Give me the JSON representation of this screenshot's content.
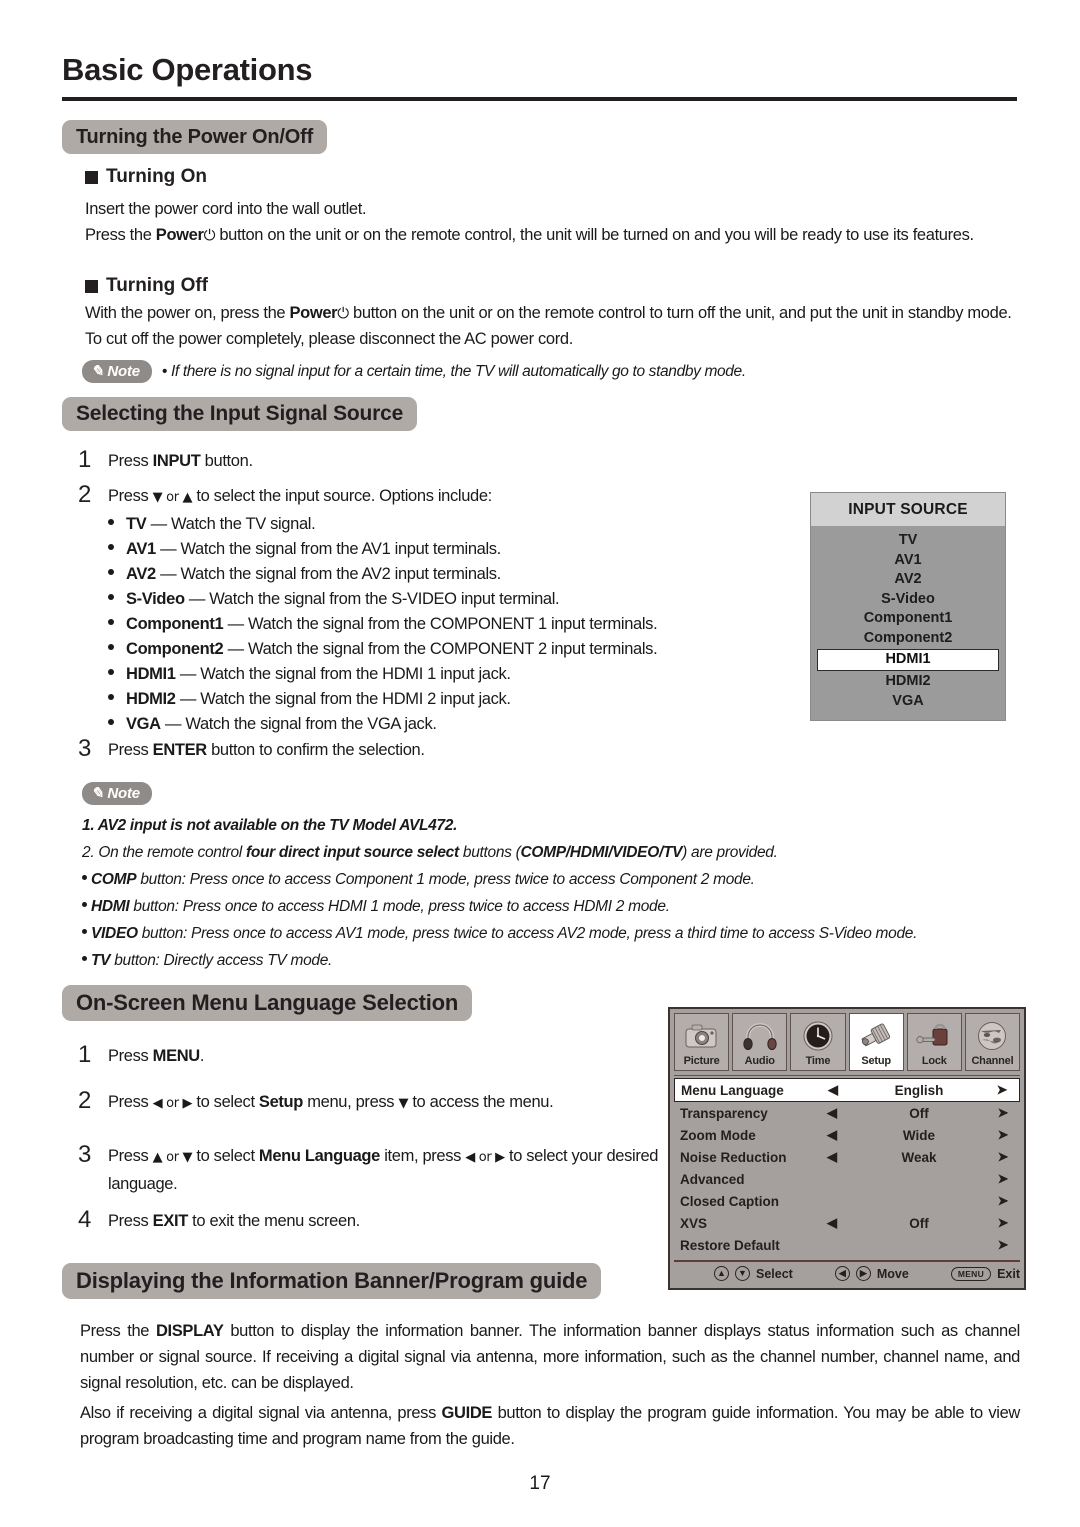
{
  "page": {
    "title": "Basic Operations",
    "number": "17"
  },
  "section_power": {
    "heading": "Turning the Power On/Off",
    "turning_on": {
      "heading": "Turning On",
      "line1": "Insert the power cord into the wall outlet.",
      "line2_pre": "Press the ",
      "line2_bold": "Power",
      "line2_symbol": "⏻",
      "line2_post": " button on the unit or on the remote control, the unit will be turned on and you will be ready to use its features."
    },
    "turning_off": {
      "heading": "Turning Off",
      "line1_pre": "With the power on, press the ",
      "line1_bold": "Power",
      "line1_symbol": "⏻",
      "line1_post": " button on the unit or on the remote control to turn off the unit, and put the unit in standby mode. To cut off the power completely, please disconnect the AC power cord."
    },
    "note": {
      "badge": "Note",
      "text": "•  If there is no signal input for a certain time, the TV will automatically go to standby mode."
    }
  },
  "section_input": {
    "heading": "Selecting the Input Signal Source",
    "steps": [
      {
        "num": "1",
        "pre": "Press ",
        "bold": "INPUT",
        "post": " button."
      },
      {
        "num": "2",
        "pre": "Press ",
        "arrows": "▼ or ▲",
        "post": " to select the input source. Options include:"
      },
      {
        "num": "3",
        "pre": "Press  ",
        "bold": "ENTER",
        "post": " button to confirm the selection."
      }
    ],
    "options": [
      {
        "name": "TV",
        "desc": "— Watch the TV signal."
      },
      {
        "name": "AV1",
        "desc": " — Watch the signal from the AV1 input terminals."
      },
      {
        "name": "AV2",
        "desc": " — Watch the signal from the AV2 input terminals."
      },
      {
        "name": "S-Video",
        "desc": "— Watch the signal from the S-VIDEO input terminal."
      },
      {
        "name": "Component1",
        "desc": " — Watch the signal from the COMPONENT 1 input terminals."
      },
      {
        "name": "Component2",
        "desc": "— Watch the signal from the COMPONENT 2 input terminals."
      },
      {
        "name": "HDMI1",
        "desc": " — Watch the signal from the HDMI 1 input jack."
      },
      {
        "name": "HDMI2",
        "desc": "— Watch the signal from the HDMI 2  input jack."
      },
      {
        "name": "VGA",
        "desc": "— Watch the signal from the VGA jack."
      }
    ],
    "osd": {
      "title": "INPUT SOURCE",
      "items": [
        {
          "label": "TV",
          "selected": false
        },
        {
          "label": "AV1",
          "selected": false
        },
        {
          "label": "AV2",
          "selected": false
        },
        {
          "label": "S-Video",
          "selected": false
        },
        {
          "label": "Component1",
          "selected": false
        },
        {
          "label": "Component2",
          "selected": false
        },
        {
          "label": "HDMI1",
          "selected": true
        },
        {
          "label": "HDMI2",
          "selected": false
        },
        {
          "label": "VGA",
          "selected": false
        }
      ]
    },
    "note": {
      "badge": "Note",
      "item1_bold": "1. AV2 input is not available on the TV Model AVL472.",
      "item2_pre": "2. On the remote control ",
      "item2_bold1": "four direct input source select",
      "item2_mid": " buttons (",
      "item2_bold2": "COMP/HDMI/VIDEO/TV",
      "item2_post": ") are provided.",
      "bullets": [
        {
          "bold": "COMP",
          "rest": " button: Press once to access Component 1 mode, press twice to access Component 2 mode."
        },
        {
          "bold": "HDMI",
          "rest": " button: Press once to access HDMI 1 mode, press twice to access HDMI 2 mode."
        },
        {
          "bold": "VIDEO",
          "rest": " button: Press once to access AV1 mode, press twice to access AV2 mode, press a third time to access S-Video mode."
        },
        {
          "bold": "TV",
          "rest": " button: Directly access TV mode."
        }
      ]
    }
  },
  "section_language": {
    "heading": "On-Screen Menu Language Selection",
    "steps": [
      {
        "num": "1",
        "pre": "Press ",
        "bold": "MENU",
        "post": "."
      },
      {
        "num": "2",
        "pre": "Press ",
        "a1": "◀ or ▶",
        "mid": " to select ",
        "bold": "Setup",
        "mid2": " menu,  press ",
        "a2": "▼",
        "post": " to access the menu."
      },
      {
        "num": "3",
        "pre": "Press ",
        "a1": "▲ or ▼",
        "mid": " to select ",
        "bold": "Menu Language",
        "mid2": " item, press ",
        "a2": "◀ or ▶",
        "post": " to select your desired language."
      },
      {
        "num": "4",
        "pre": "Press ",
        "bold": "EXIT",
        "post": " to exit the menu screen."
      }
    ],
    "osd": {
      "tabs": [
        {
          "label": "Picture",
          "icon": "camera-icon",
          "active": false
        },
        {
          "label": "Audio",
          "icon": "headphones-icon",
          "active": false
        },
        {
          "label": "Time",
          "icon": "clock-icon",
          "active": false
        },
        {
          "label": "Setup",
          "icon": "screw-icon",
          "active": true
        },
        {
          "label": "Lock",
          "icon": "padlock-icon",
          "active": false
        },
        {
          "label": "Channel",
          "icon": "globe-icon",
          "active": false
        }
      ],
      "rows": [
        {
          "label": "Menu Language",
          "left": "◀",
          "value": "English",
          "right": "➤",
          "selected": true
        },
        {
          "label": "Transparency",
          "left": "◀",
          "value": "Off",
          "right": "➤",
          "selected": false
        },
        {
          "label": "Zoom Mode",
          "left": "◀",
          "value": "Wide",
          "right": "➤",
          "selected": false
        },
        {
          "label": "Noise Reduction",
          "left": "◀",
          "value": "Weak",
          "right": "➤",
          "selected": false
        },
        {
          "label": "Advanced",
          "left": "",
          "value": "",
          "right": "➤",
          "selected": false
        },
        {
          "label": "Closed Caption",
          "left": "",
          "value": "",
          "right": "➤",
          "selected": false
        },
        {
          "label": "XVS",
          "left": "◀",
          "value": "Off",
          "right": "➤",
          "selected": false
        },
        {
          "label": "Restore Default",
          "left": "",
          "value": "",
          "right": "➤",
          "selected": false
        }
      ],
      "footer": {
        "select_keys": [
          "▲",
          "▼"
        ],
        "select_label": "Select",
        "move_keys": [
          "◀",
          "▶"
        ],
        "move_label": "Move",
        "exit_key": "MENU",
        "exit_label": "Exit"
      }
    }
  },
  "section_banner": {
    "heading": "Displaying the Information Banner/Program guide",
    "para1_pre": "Press the ",
    "para1_bold": "DISPLAY",
    "para1_post": " button to display the information banner. The information banner displays status information such as channel number or signal source. If receiving a digital signal via antenna, more information, such as the channel number, channel name, and signal resolution, etc. can be displayed.",
    "para2_pre": "Also if receiving a digital signal via antenna, press ",
    "para2_bold": "GUIDE",
    "para2_post": " button to display the program guide information. You may be able to view program broadcasting time and program name from the guide."
  }
}
